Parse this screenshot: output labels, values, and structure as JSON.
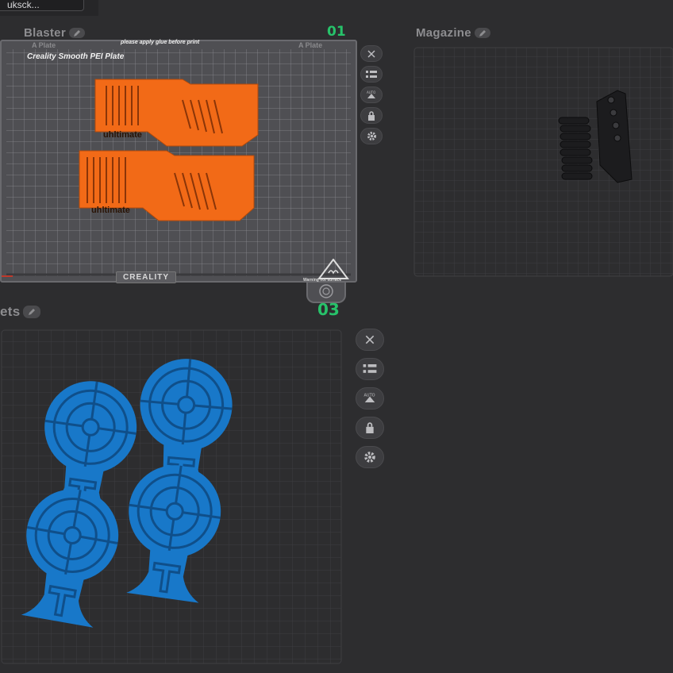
{
  "top_dropdown": {
    "value": "uksck..."
  },
  "plates": {
    "blaster": {
      "title": "Blaster",
      "number": "01"
    },
    "magazine": {
      "title": "Magazine"
    },
    "targets": {
      "title": "ets",
      "number": "03"
    }
  },
  "bed": {
    "plate_name": "Creality Smooth PEI Plate",
    "top_notice": "please apply glue before print",
    "tab_left": "A Plate",
    "tab_right": "A Plate",
    "brand": "CREALITY",
    "warning": "Warning hot surface"
  },
  "parts": {
    "blaster_label_1": "uhltimate",
    "blaster_label_2": "uhltimate"
  },
  "colors": {
    "orange": "#f26a17",
    "blue": "#1878c9",
    "green_number": "#27c26a",
    "dark_part": "#1c1c1e"
  },
  "icons": [
    "close-icon",
    "list-icon",
    "auto-orient-icon",
    "lock-icon",
    "gear-icon"
  ]
}
